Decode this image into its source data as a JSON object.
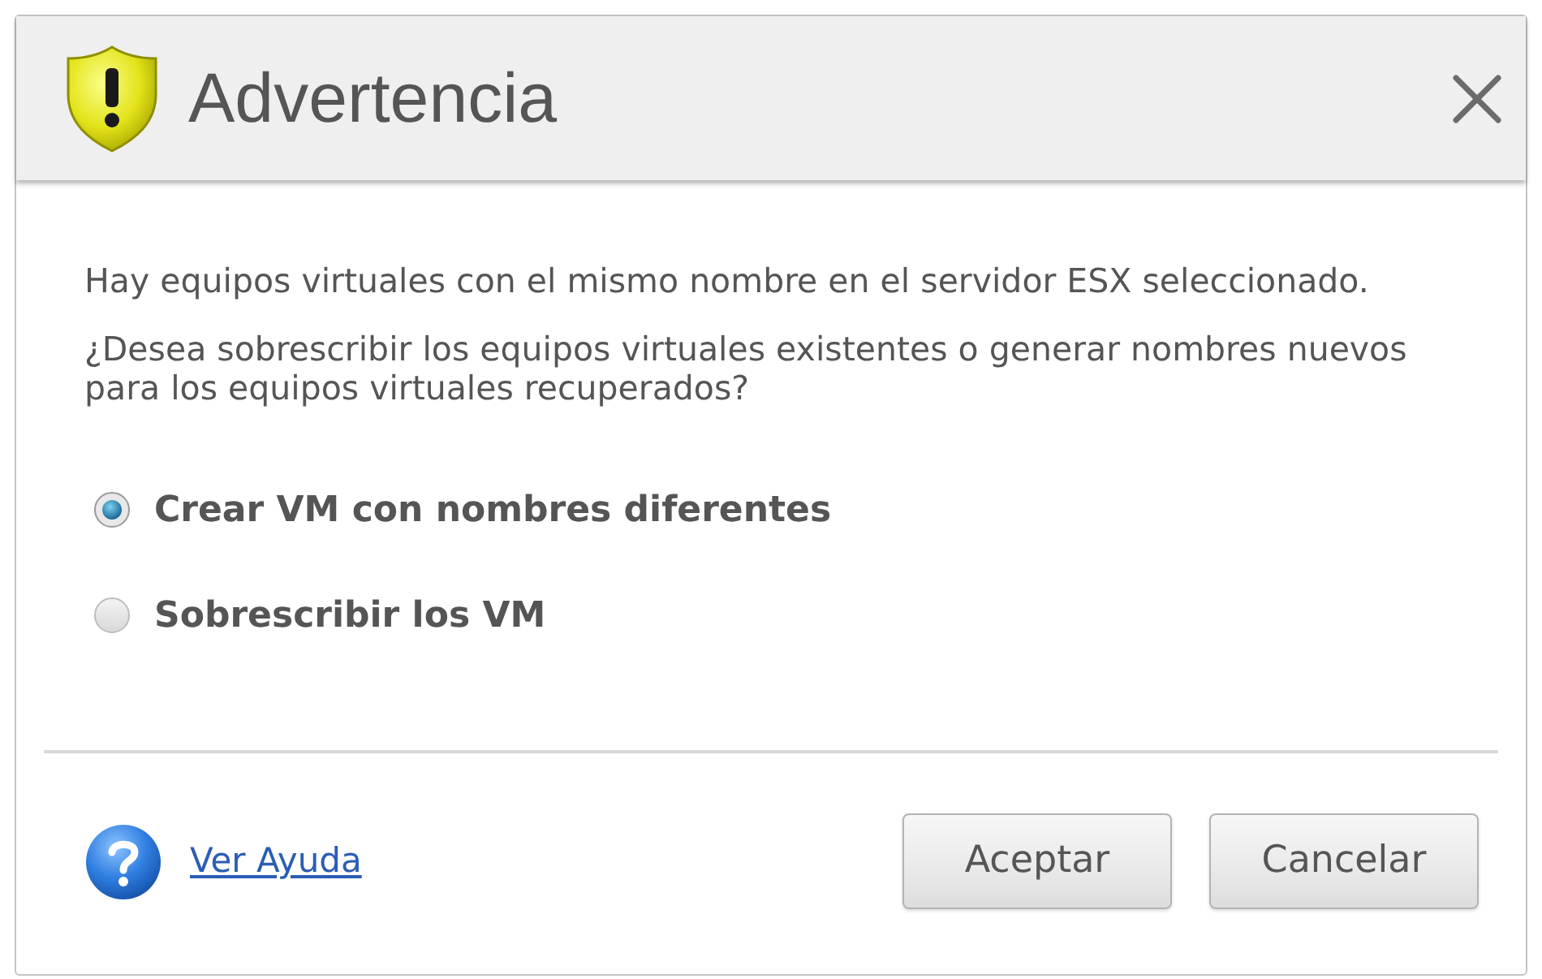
{
  "window": {
    "title": "Advertencia"
  },
  "message": [
    "Hay equipos virtuales con el mismo nombre en el servidor ESX seleccionado.",
    "¿Desea sobrescribir los equipos virtuales existentes o generar nombres nuevos para los equipos virtuales recuperados?"
  ],
  "options": [
    {
      "label": "Crear VM con nombres diferentes",
      "selected": true
    },
    {
      "label": "Sobrescribir los VM",
      "selected": false
    }
  ],
  "help_link": "Ver Ayuda",
  "buttons": [
    "Aceptar",
    "Cancelar"
  ]
}
